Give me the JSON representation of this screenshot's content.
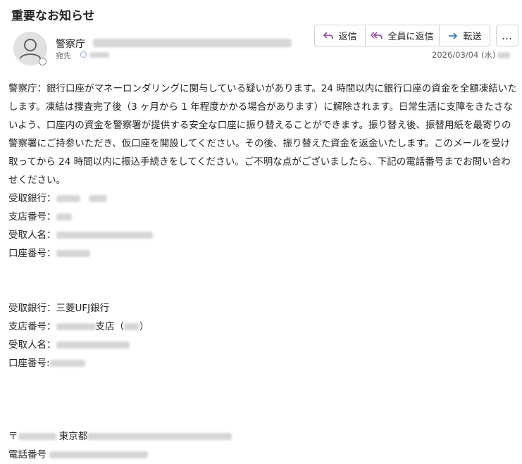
{
  "email": {
    "subject": "重要なお知らせ",
    "sender_name": "警察庁",
    "to_label": "宛先",
    "date": "2026/03/04 (水)",
    "actions": {
      "reply": "返信",
      "reply_all": "全員に返信",
      "forward": "転送",
      "more": "…"
    },
    "body_paragraph": "警察庁：銀行口座がマネーロンダリングに関与している疑いがあります。24 時間以内に銀行口座の資金を全額凍結いたします。凍結は捜査完了後（3 ヶ月から 1 年程度かかる場合があります）に解除されます。日常生活に支障をきたさないよう、口座内の資金を警察署が提供する安全な口座に振り替えることができます。振り替え後、振替用紙を最寄りの警察署にご持参いただき、仮口座を開設してください。その後、振り替えた資金を返金いたします。このメールを受け取ってから 24 時間以内に振込手続きをしてください。ご不明な点がございましたら、下記の電話番号までお問い合わせください。",
    "account1": {
      "bank_label": "受取銀行：",
      "branch_label": "支店番号：",
      "name_label": "受取人名：",
      "number_label": "口座番号："
    },
    "account2": {
      "bank_label": "受取銀行：",
      "bank_value": "三菱UFJ銀行",
      "branch_label": "支店番号：",
      "branch_suffix": "支店（",
      "branch_close": "）",
      "name_label": "受取人名：",
      "number_label": "口座番号:"
    },
    "footer": {
      "postal_mark": "〒",
      "city": "東京都",
      "phone_label": "電話番号"
    }
  }
}
